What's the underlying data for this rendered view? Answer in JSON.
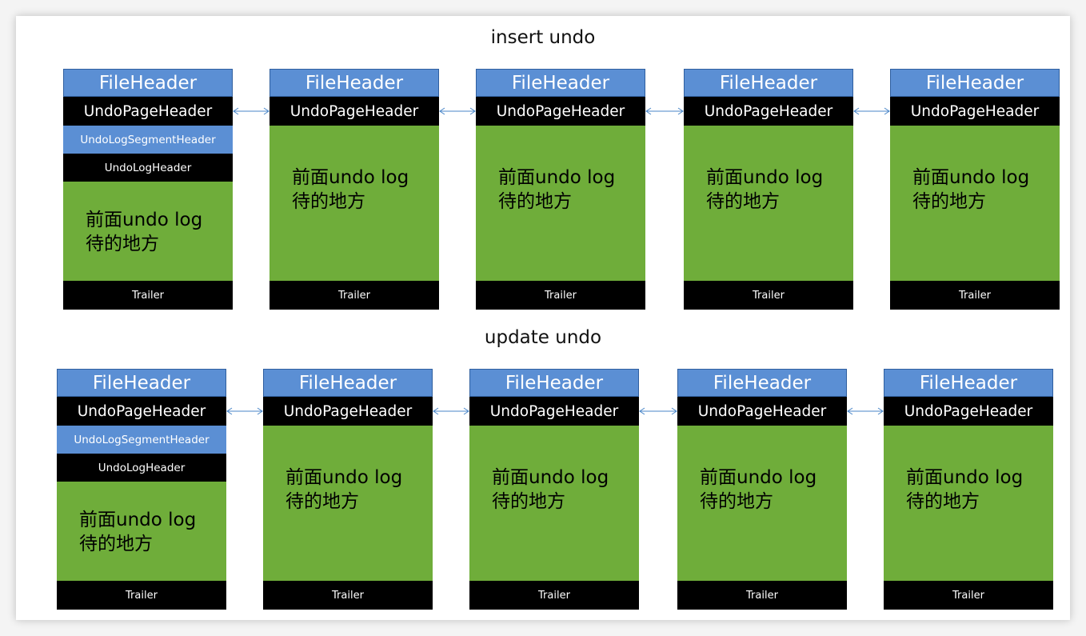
{
  "sections": [
    {
      "title": "insert undo",
      "pages": [
        {
          "file_header": "FileHeader",
          "page_header": "UndoPageHeader",
          "segment_header": "UndoLogSegmentHeader",
          "log_header": "UndoLogHeader",
          "body": [
            "前面undo log",
            "待的地方"
          ],
          "trailer": "Trailer"
        },
        {
          "file_header": "FileHeader",
          "page_header": "UndoPageHeader",
          "body": [
            "前面undo log",
            "待的地方"
          ],
          "trailer": "Trailer"
        },
        {
          "file_header": "FileHeader",
          "page_header": "UndoPageHeader",
          "body": [
            "前面undo log",
            "待的地方"
          ],
          "trailer": "Trailer"
        },
        {
          "file_header": "FileHeader",
          "page_header": "UndoPageHeader",
          "body": [
            "前面undo log",
            "待的地方"
          ],
          "trailer": "Trailer"
        },
        {
          "file_header": "FileHeader",
          "page_header": "UndoPageHeader",
          "body": [
            "前面undo log",
            "待的地方"
          ],
          "trailer": "Trailer"
        }
      ]
    },
    {
      "title": "update undo",
      "pages": [
        {
          "file_header": "FileHeader",
          "page_header": "UndoPageHeader",
          "segment_header": "UndoLogSegmentHeader",
          "log_header": "UndoLogHeader",
          "body": [
            "前面undo log",
            "待的地方"
          ],
          "trailer": "Trailer"
        },
        {
          "file_header": "FileHeader",
          "page_header": "UndoPageHeader",
          "body": [
            "前面undo log",
            "待的地方"
          ],
          "trailer": "Trailer"
        },
        {
          "file_header": "FileHeader",
          "page_header": "UndoPageHeader",
          "body": [
            "前面undo log",
            "待的地方"
          ],
          "trailer": "Trailer"
        },
        {
          "file_header": "FileHeader",
          "page_header": "UndoPageHeader",
          "body": [
            "前面undo log",
            "待的地方"
          ],
          "trailer": "Trailer"
        },
        {
          "file_header": "FileHeader",
          "page_header": "UndoPageHeader",
          "body": [
            "前面undo log",
            "待的地方"
          ],
          "trailer": "Trailer"
        }
      ]
    }
  ],
  "colors": {
    "file_header": "#5b8fd4",
    "page_header": "#000000",
    "body": "#6fad3a",
    "connector": "#4a86c8"
  }
}
